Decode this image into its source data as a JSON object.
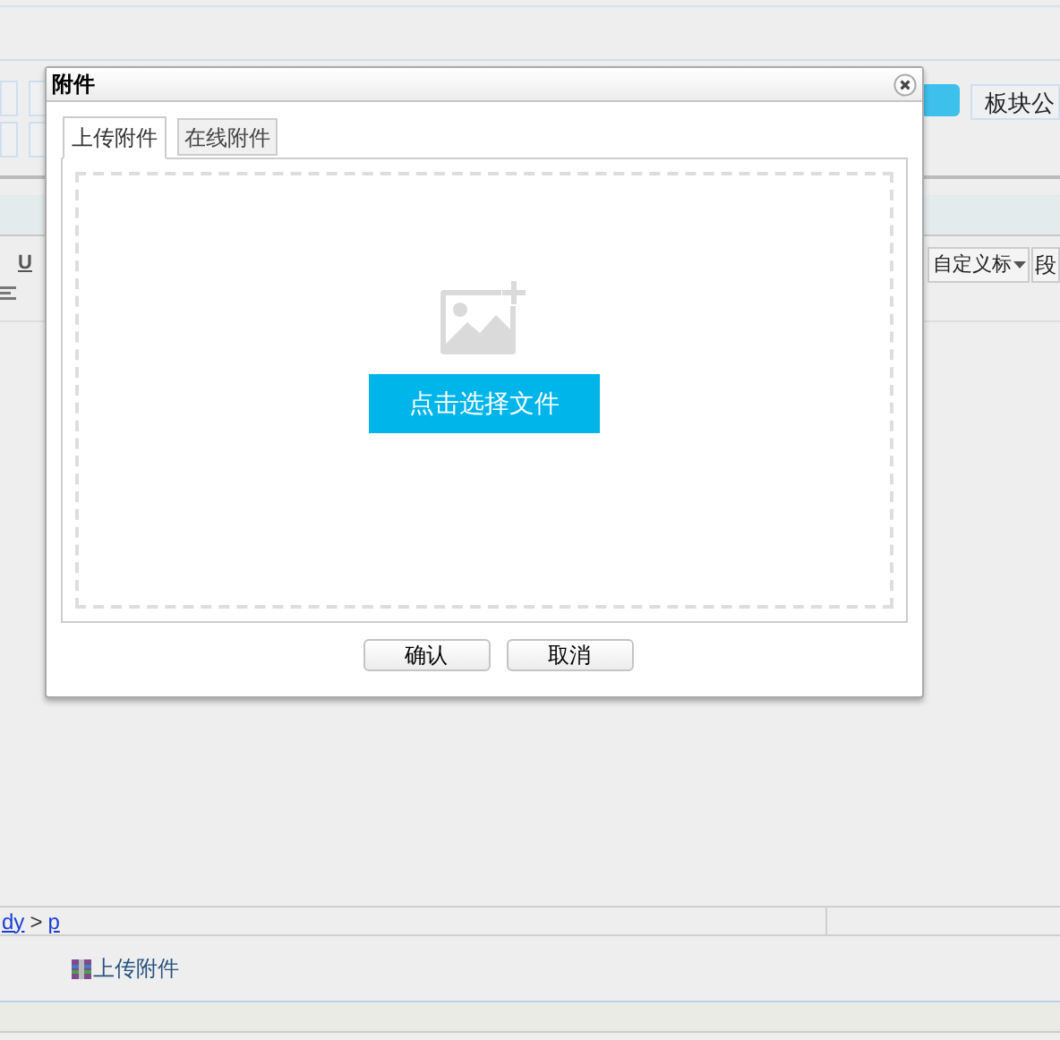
{
  "editor": {
    "toolbar_buttons": [
      {
        "label": "板块公"
      }
    ],
    "format_select": {
      "value": "自定义标"
    },
    "paragraph_button": "段",
    "underline_button": "U",
    "breadcrumb": [
      {
        "label": "dy"
      },
      {
        "label": "p"
      }
    ],
    "breadcrumb_separator": ">",
    "attachments": [
      {
        "name": "上传附件"
      }
    ]
  },
  "dialog": {
    "title": "附件",
    "tabs": [
      {
        "label": "上传附件",
        "selected": true
      },
      {
        "label": "在线附件",
        "selected": false
      }
    ],
    "upload_button": "点击选择文件",
    "buttons": [
      "确认",
      "取消"
    ]
  }
}
